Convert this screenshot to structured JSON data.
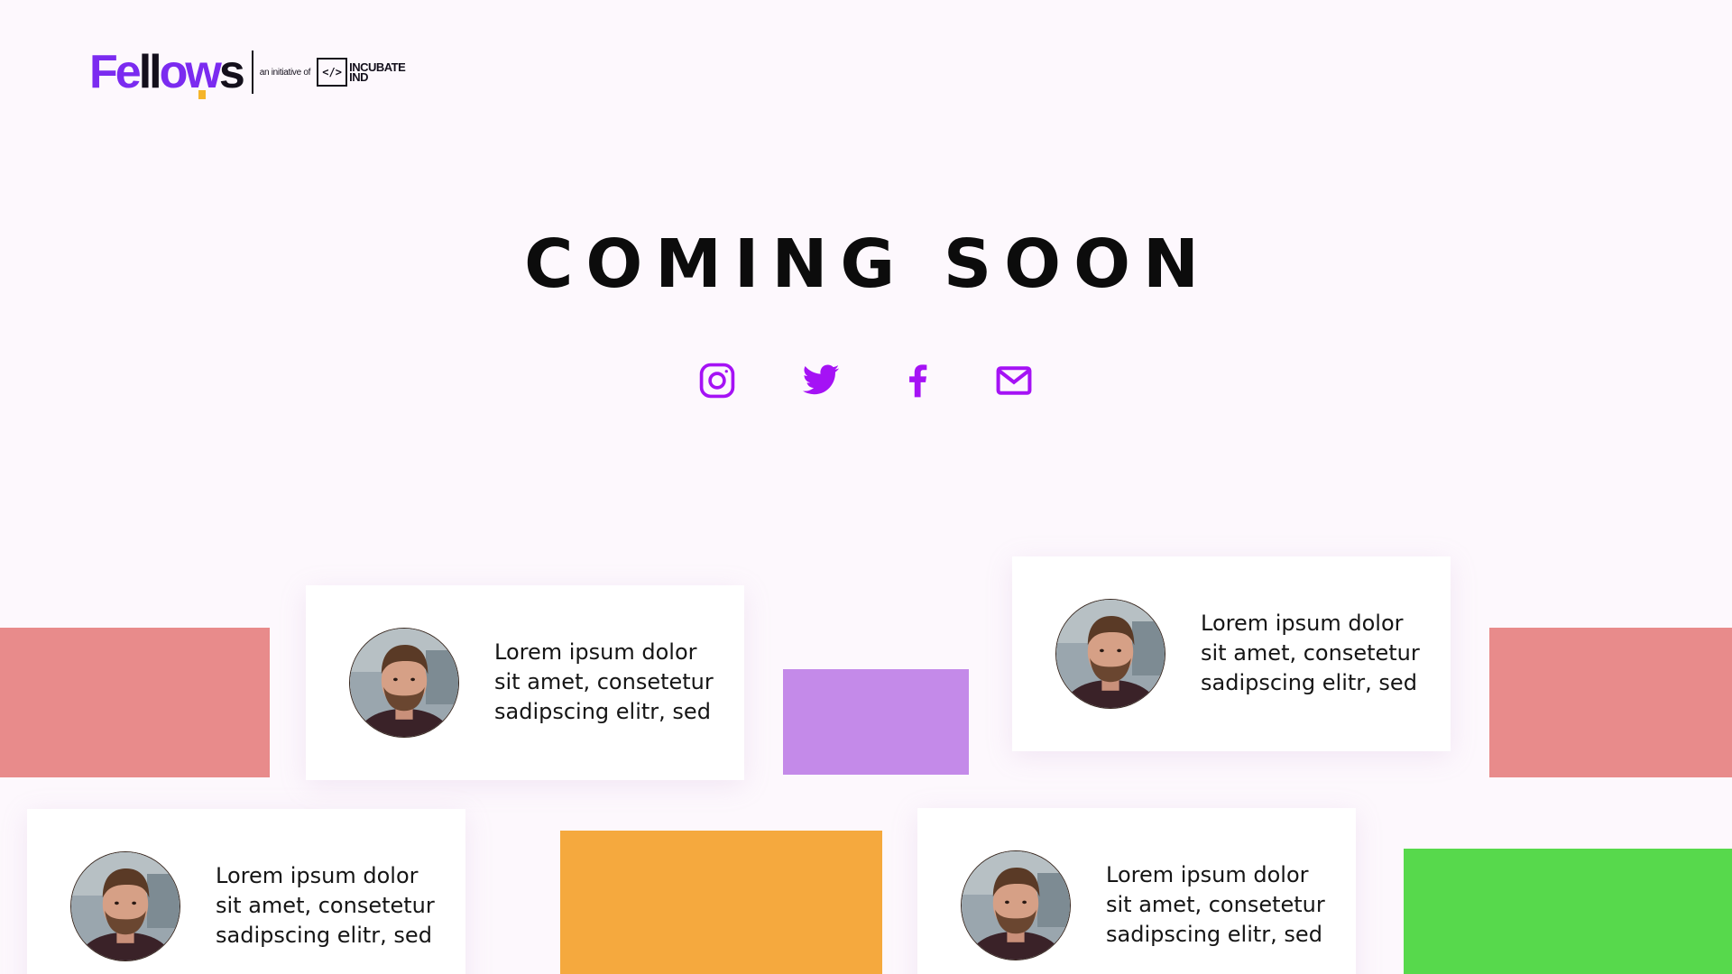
{
  "logo": {
    "brand_prefix": "Fe",
    "brand_ll": "ll",
    "brand_o": "o",
    "brand_w": "w",
    "brand_s": "s",
    "initiative_text": "an initiative of",
    "incubate_symbol": "</>",
    "incubate_line1": "INCUBATE",
    "incubate_line2": "IND"
  },
  "headline": "COMING SOON",
  "social": [
    {
      "name": "instagram",
      "icon": "instagram-icon"
    },
    {
      "name": "twitter",
      "icon": "twitter-icon"
    },
    {
      "name": "facebook",
      "icon": "facebook-icon"
    },
    {
      "name": "email",
      "icon": "mail-icon"
    }
  ],
  "colors": {
    "accent": "#a512f5",
    "background": "#fdf8fd",
    "block_red": "#e88b8b",
    "block_purple": "#c48ae9",
    "block_orange": "#f5a93e",
    "block_green": "#57d94c"
  },
  "cards": [
    {
      "line1": "Lorem ipsum dolor",
      "line2": "sit amet, consetetur",
      "line3": "sadipscing elitr, sed"
    },
    {
      "line1": "Lorem ipsum dolor",
      "line2": "sit amet, consetetur",
      "line3": "sadipscing elitr, sed"
    },
    {
      "line1": "Lorem ipsum dolor",
      "line2": "sit amet, consetetur",
      "line3": "sadipscing elitr, sed"
    },
    {
      "line1": "Lorem ipsum dolor",
      "line2": "sit amet, consetetur",
      "line3": "sadipscing elitr, sed"
    }
  ]
}
